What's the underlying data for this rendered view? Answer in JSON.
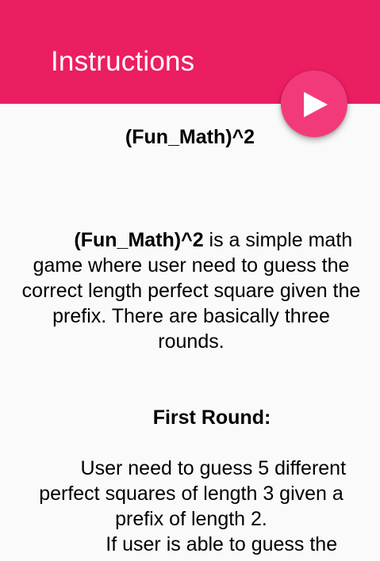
{
  "header": {
    "title": "Instructions",
    "play_button_icon": "play-icon"
  },
  "content": {
    "main_title": "(Fun_Math)^2",
    "intro": {
      "bold_lead": "(Fun_Math)^2",
      "text": " is a simple math game where user need to guess the correct length perfect square given the prefix. There are basically three rounds."
    },
    "first_round": {
      "title": "First Round:",
      "text_line_1": "User need to guess 5 different perfect squares of length 3 given a prefix of length 2.",
      "text_line_2": "If user is able to guess the"
    }
  },
  "colors": {
    "appbar": "#ec1e62",
    "fab": "#f23a7b",
    "background": "#fafafa"
  }
}
